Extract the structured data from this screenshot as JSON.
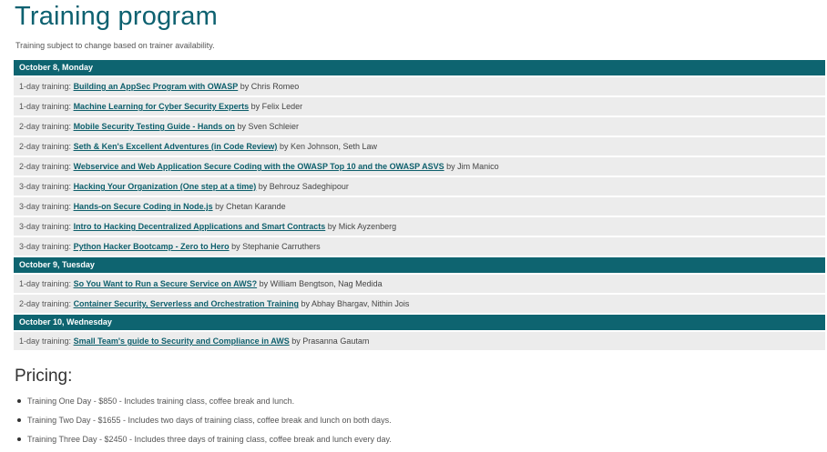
{
  "title": "Training program",
  "subtitle": "Training subject to change based on trainer availability.",
  "days": [
    {
      "label": "October 8, Monday",
      "sessions": [
        {
          "duration": "1-day training:",
          "topic": "Building an AppSec Program with OWASP",
          "by": "by Chris Romeo"
        },
        {
          "duration": "1-day training:",
          "topic": "Machine Learning for Cyber Security Experts",
          "by": "by Felix Leder"
        },
        {
          "duration": "2-day training:",
          "topic": "Mobile Security Testing Guide - Hands on",
          "by": "by Sven Schleier"
        },
        {
          "duration": "2-day training:",
          "topic": "Seth & Ken's Excellent Adventures (in Code Review)",
          "by": "by Ken Johnson, Seth Law"
        },
        {
          "duration": "2-day training:",
          "topic": "Webservice and Web Application Secure Coding with the OWASP Top 10 and the OWASP ASVS",
          "by": "by Jim Manico"
        },
        {
          "duration": "3-day training:",
          "topic": "Hacking Your Organization (One step at a time)",
          "by": "by Behrouz Sadeghipour"
        },
        {
          "duration": "3-day training:",
          "topic": "Hands-on Secure Coding in Node.js",
          "by": "by Chetan Karande"
        },
        {
          "duration": "3-day training:",
          "topic": "Intro to Hacking Decentralized Applications and Smart Contracts",
          "by": "by Mick Ayzenberg"
        },
        {
          "duration": "3-day training:",
          "topic": "Python Hacker Bootcamp - Zero to Hero",
          "by": "by Stephanie Carruthers"
        }
      ]
    },
    {
      "label": "October 9, Tuesday",
      "sessions": [
        {
          "duration": "1-day training:",
          "topic": "So You Want to Run a Secure Service on AWS?",
          "by": "by William Bengtson, Nag Medida"
        },
        {
          "duration": "2-day training:",
          "topic": "Container Security, Serverless and Orchestration Training",
          "by": "by Abhay Bhargav, Nithin Jois"
        }
      ]
    },
    {
      "label": "October 10, Wednesday",
      "sessions": [
        {
          "duration": "1-day training:",
          "topic": "Small Team's guide to Security and Compliance in AWS",
          "by": "by Prasanna Gautam"
        }
      ]
    }
  ],
  "pricing": {
    "heading": "Pricing:",
    "items": [
      "Training One Day - $850 - Includes training class, coffee break and lunch.",
      "Training Two Day - $1655 - Includes two days of training class, coffee break and lunch on both days.",
      "Training Three Day - $2450 - Includes three days of training class, coffee break and lunch every day."
    ]
  }
}
